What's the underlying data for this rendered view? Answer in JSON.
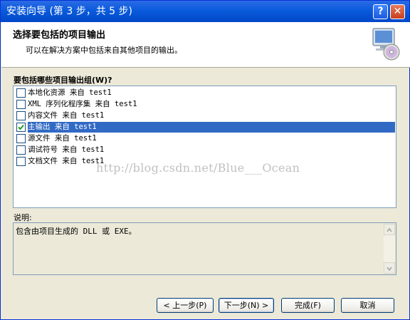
{
  "window": {
    "title": "安装向导 (第 3 步，共 5 步)",
    "help_label": "?",
    "close_label": "✕"
  },
  "header": {
    "title": "选择要包括的项目输出",
    "subtitle": "可以在解决方案中包括来自其他项目的输出。",
    "icon": "computer-cd-icon"
  },
  "outputs": {
    "label": "要包括哪些项目输出组(W)?",
    "items": [
      {
        "label": "本地化资源 来自 test1",
        "checked": false,
        "selected": false
      },
      {
        "label": "XML 序列化程序集 来自 test1",
        "checked": false,
        "selected": false
      },
      {
        "label": "内容文件 来自 test1",
        "checked": false,
        "selected": false
      },
      {
        "label": "主输出 来自 test1",
        "checked": true,
        "selected": true
      },
      {
        "label": "源文件 来自 test1",
        "checked": false,
        "selected": false
      },
      {
        "label": "调试符号 来自 test1",
        "checked": false,
        "selected": false
      },
      {
        "label": "文档文件 来自 test1",
        "checked": false,
        "selected": false
      }
    ]
  },
  "watermark": "http://blog.csdn.net/Blue___Ocean",
  "description": {
    "label": "说明:",
    "text": "包含由项目生成的 DLL 或 EXE。"
  },
  "buttons": {
    "back": "< 上一步(P)",
    "next": "下一步(N) >",
    "finish": "完成(F)",
    "cancel": "取消"
  }
}
